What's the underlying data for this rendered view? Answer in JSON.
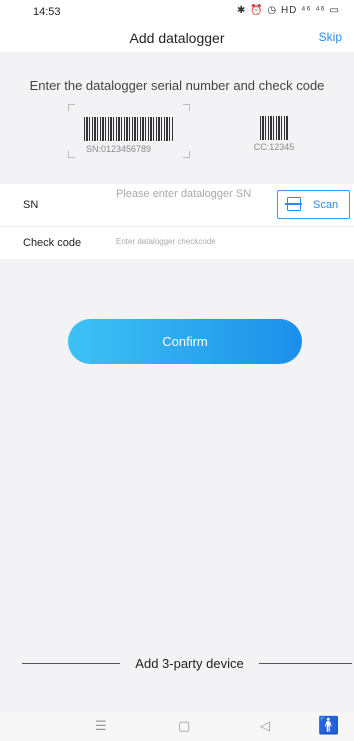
{
  "status": {
    "time": "14:53",
    "icons": "✱ ⏰ ◷ HD ⁴⁶ ⁴⁶ ▭"
  },
  "header": {
    "title": "Add datalogger",
    "skip_label": "Skip"
  },
  "instruction": "Enter the datalogger serial number and check code",
  "samples": {
    "sn": "SN:0123456789",
    "cc": "CC:12345"
  },
  "form": {
    "sn_label": "SN",
    "sn_placeholder": "Please enter datalogger SN",
    "scan_label": "Scan",
    "check_label": "Check code",
    "check_placeholder": "Enter datalogger checkcode"
  },
  "confirm_label": "Confirm",
  "third_party_label": "Add 3-party device",
  "nav": {
    "menu": "☰",
    "home": "▢",
    "back": "◁",
    "a11y": "🚹"
  },
  "colors": {
    "accent": "#2a8cf2",
    "button_start": "#3ec2f4",
    "button_end": "#1c8fea"
  }
}
